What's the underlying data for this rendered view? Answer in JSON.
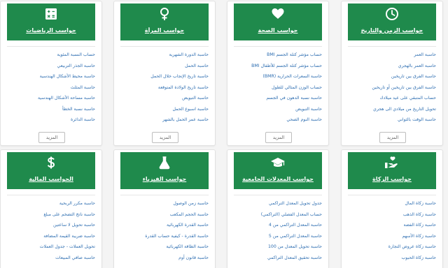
{
  "cards": [
    {
      "title": "حواسب الزمن والتاريخ",
      "icon": "clock-icon",
      "links": [
        "حاسبة العمر",
        "حاسبة العمر بالهجري",
        "حاسبة الفرق بين تاريخين",
        "حاسبة الفرق بين تاريخين أو تاريخين",
        "حساب المتبقي على عيد ميلادك",
        "تحويل التاريخ من ميلادي الى هجري",
        "حاسبة الوقت بالثواني"
      ],
      "more": "المزيد"
    },
    {
      "title": "حواسب الصحة",
      "icon": "heart-icon",
      "links": [
        "حساب مؤشر كتلة الجسم BMI",
        "حساب مؤشر كتلة الجسم للأطفال BMI",
        "حاسبة السعرات الحرارية (BMR)",
        "حساب الوزن المثالي للطول",
        "حاسبة نسبة الدهون في الجسم",
        "حاسبة التبويض",
        "حاسبة النوم الصحي"
      ],
      "more": "المزيد"
    },
    {
      "title": "حواسب المرأة",
      "icon": "female-icon",
      "links": [
        "حاسبة الدورة الشهرية",
        "حاسبة الحمل",
        "حاسبة تاريخ الإنجاب خلال الحمل",
        "حاسبة تاريخ الولادة المتوقعة",
        "حاسبة التبويض",
        "حاسبة اسبوع الحمل",
        "حاسبة عمر الحمل بالشهر"
      ],
      "more": "المزيد"
    },
    {
      "title": "حواسب الرياضيات",
      "icon": "calculator-icon",
      "links": [
        "حساب النسبة المئوية",
        "حاسبة الجذر التربيعي",
        "حاسبة محيط الأشكال الهندسية",
        "حاسبة المثلث",
        "حاسبة مساحة الأشكال الهندسية",
        "حاسبة نسبة الخطأ",
        "حاسبة الدائرة"
      ],
      "more": "المزيد"
    },
    {
      "title": "حواسب الزكاة",
      "icon": "hand-coin-icon",
      "links": [
        "حاسبة زكاة المال",
        "حاسبة زكاة الذهب",
        "حاسبة زكاة الفضة",
        "حاسبة زكاة الأسهم",
        "حاسبة زكاة عروض التجارة",
        "حاسبة زكاة الحبوب"
      ]
    },
    {
      "title": "حواسب المعدلات الجامعية",
      "icon": "graduation-cap-icon",
      "links": [
        "جدول تحويل المعدل التراكمي",
        "حساب المعدل الفصلي (التراكمي)",
        "حاسبة المعدل التراكمي من 4",
        "حاسبة المعدل التراكمي من 5",
        "حاسبة تحويل المعدل من 100",
        "حاسبة تحقيق المعدل التراكمي"
      ]
    },
    {
      "title": "حواسب الفيزياء",
      "icon": "flask-icon",
      "links": [
        "حاسبة زمن الوصول",
        "حاسبة الحجم المكعب",
        "حاسبة القدرة الكهربائية",
        "حاسبة القدرة - كيفية حساب القدرة",
        "حاسبة الطاقة الكهربائية",
        "حاسبة قانون أوم"
      ]
    },
    {
      "title": "الحواسب المالية",
      "icon": "dollar-icon",
      "links": [
        "حاسبة مكرر الربحية",
        "حاسبة ناتج التضخم على مبلغ",
        "حاسبة تحويل لا ساعتين",
        "حاسبة ضريبة القيمة المضافة",
        "تحويل العملات - جدول العملات",
        "حاسبة صافي المبيعات"
      ]
    }
  ]
}
